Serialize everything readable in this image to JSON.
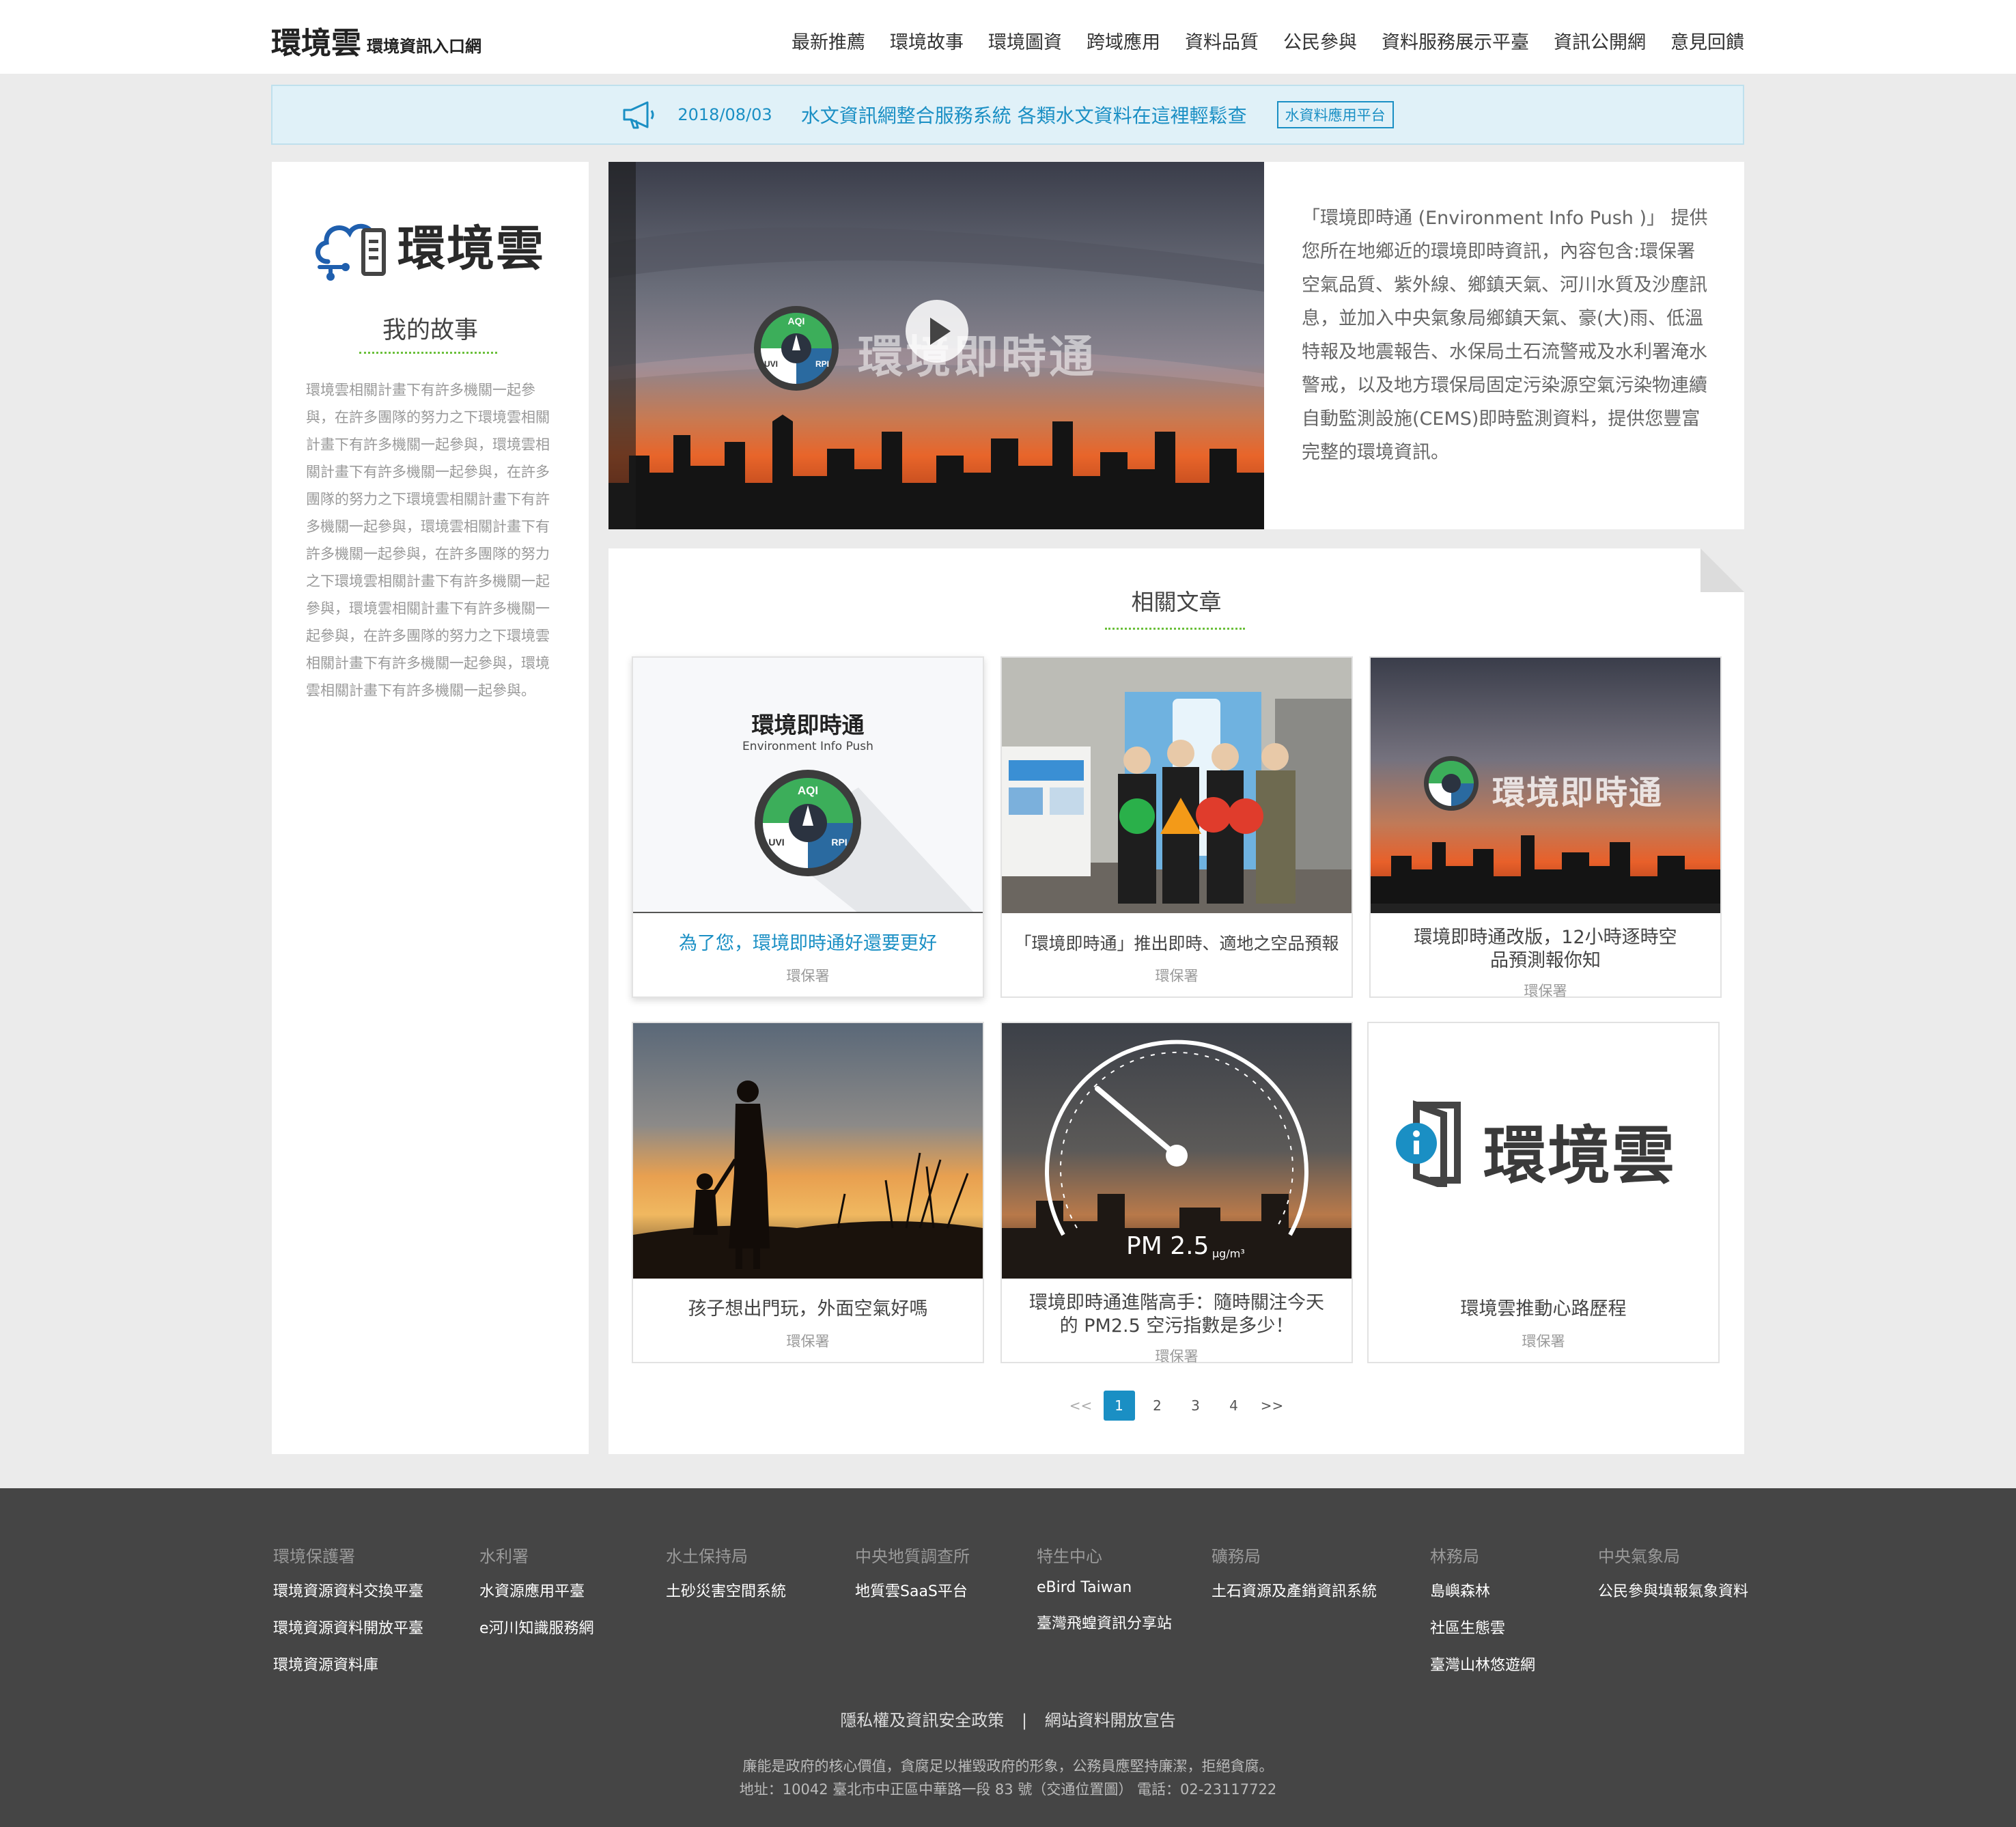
{
  "header": {
    "logo_main": "環境雲",
    "logo_sub": "環境資訊入口網",
    "nav": [
      "最新推薦",
      "環境故事",
      "環境圖資",
      "跨域應用",
      "資料品質",
      "公民參與",
      "資料服務展示平臺",
      "資訊公開網",
      "意見回饋"
    ]
  },
  "announcement": {
    "date": "2018/08/03",
    "message": "水文資訊網整合服務系統 各類水文資料在這裡輕鬆查",
    "tag": "水資料應用平台"
  },
  "sidebar": {
    "logo_text": "環境雲",
    "title": "我的故事",
    "body": "環境雲相關計畫下有許多機關一起參與，在許多團隊的努力之下環境雲相關計畫下有許多機關一起參與，環境雲相關計畫下有許多機關一起參與，在許多團隊的努力之下環境雲相關計畫下有許多機關一起參與，環境雲相關計畫下有許多機關一起參與，在許多團隊的努力之下環境雲相關計畫下有許多機關一起參與，環境雲相關計畫下有許多機關一起參與，在許多團隊的努力之下環境雲相關計畫下有許多機關一起參與，環境雲相關計畫下有許多機關一起參與。"
  },
  "feature": {
    "video_overlay_text": "環境即時通",
    "gauge_labels": {
      "aqi": "AQI",
      "uvi": "UVI",
      "rpi": "RPI"
    },
    "description": "「環境即時通 (Environment Info Push )」 提供您所在地鄉近的環境即時資訊，內容包含:環保署空氣品質、紫外線、鄉鎮天氣、河川水質及沙塵訊息，並加入中央氣象局鄉鎮天氣、豪(大)雨、低溫特報及地震報告、水保局土石流警戒及水利署淹水警戒，以及地方環保局固定污染源空氣污染物連續自動監測設施(CEMS)即時監測資料，提供您豐富完整的環境資訊。"
  },
  "articles": {
    "title": "相關文章",
    "thumb1_title": "環境即時通",
    "thumb1_subtitle": "Environment Info Push",
    "thumb3_overlay": "環境即時通",
    "thumb5_overlay": "PM 2.5",
    "thumb5_unit": "μg/m³",
    "thumb6_logo": "環境雲",
    "items": [
      {
        "title": "為了您，環境即時通好還要更好",
        "source": "環保署"
      },
      {
        "title": "「環境即時通」推出即時、適地之空品預報",
        "source": "環保署"
      },
      {
        "title": "環境即時通改版，12小時逐時空品預測報你知",
        "source": "環保署"
      },
      {
        "title": "孩子想出門玩，外面空氣好嗎",
        "source": "環保署"
      },
      {
        "title": "環境即時通進階高手：隨時關注今天的 PM2.5 空污指數是多少！",
        "source": "環保署"
      },
      {
        "title": "環境雲推動心路歷程",
        "source": "環保署"
      }
    ],
    "pager": {
      "prev": "<<",
      "pages": [
        "1",
        "2",
        "3",
        "4"
      ],
      "next": ">>",
      "current": 1
    }
  },
  "footer": {
    "columns": [
      {
        "heading": "環境保護署",
        "items": [
          "環境資源資料交換平臺",
          "環境資源資料開放平臺",
          "環境資源資料庫"
        ]
      },
      {
        "heading": "水利署",
        "items": [
          "水資源應用平臺",
          "e河川知識服務網"
        ]
      },
      {
        "heading": "水土保持局",
        "items": [
          "土砂災害空間系統"
        ]
      },
      {
        "heading": "中央地質調查所",
        "items": [
          "地質雲SaaS平台"
        ]
      },
      {
        "heading": "特生中心",
        "items": [
          "eBird Taiwan",
          "臺灣飛蝗資訊分享站"
        ]
      },
      {
        "heading": "礦務局",
        "items": [
          "土石資源及產銷資訊系統"
        ]
      },
      {
        "heading": "林務局",
        "items": [
          "島嶼森林",
          "社區生態雲",
          "臺灣山林悠遊網"
        ]
      },
      {
        "heading": "中央氣象局",
        "items": [
          "公民參與填報氣象資料"
        ]
      }
    ],
    "privacy": "隱私權及資訊安全政策",
    "separator": "|",
    "open_data": "網站資料開放宣告",
    "integrity": "廉能是政府的核心價值，貪腐足以摧毀政府的形象，公務員應堅持廉潔，拒絕貪腐。",
    "address": "地址：10042 臺北市中正區中華路一段 83 號（交通位置圖） 電話：02-23117722"
  },
  "colors": {
    "accent": "#1a8fc4",
    "dotted_line": "#6abf3a",
    "footer_bg": "#454545",
    "page_bg": "#ebebeb"
  }
}
